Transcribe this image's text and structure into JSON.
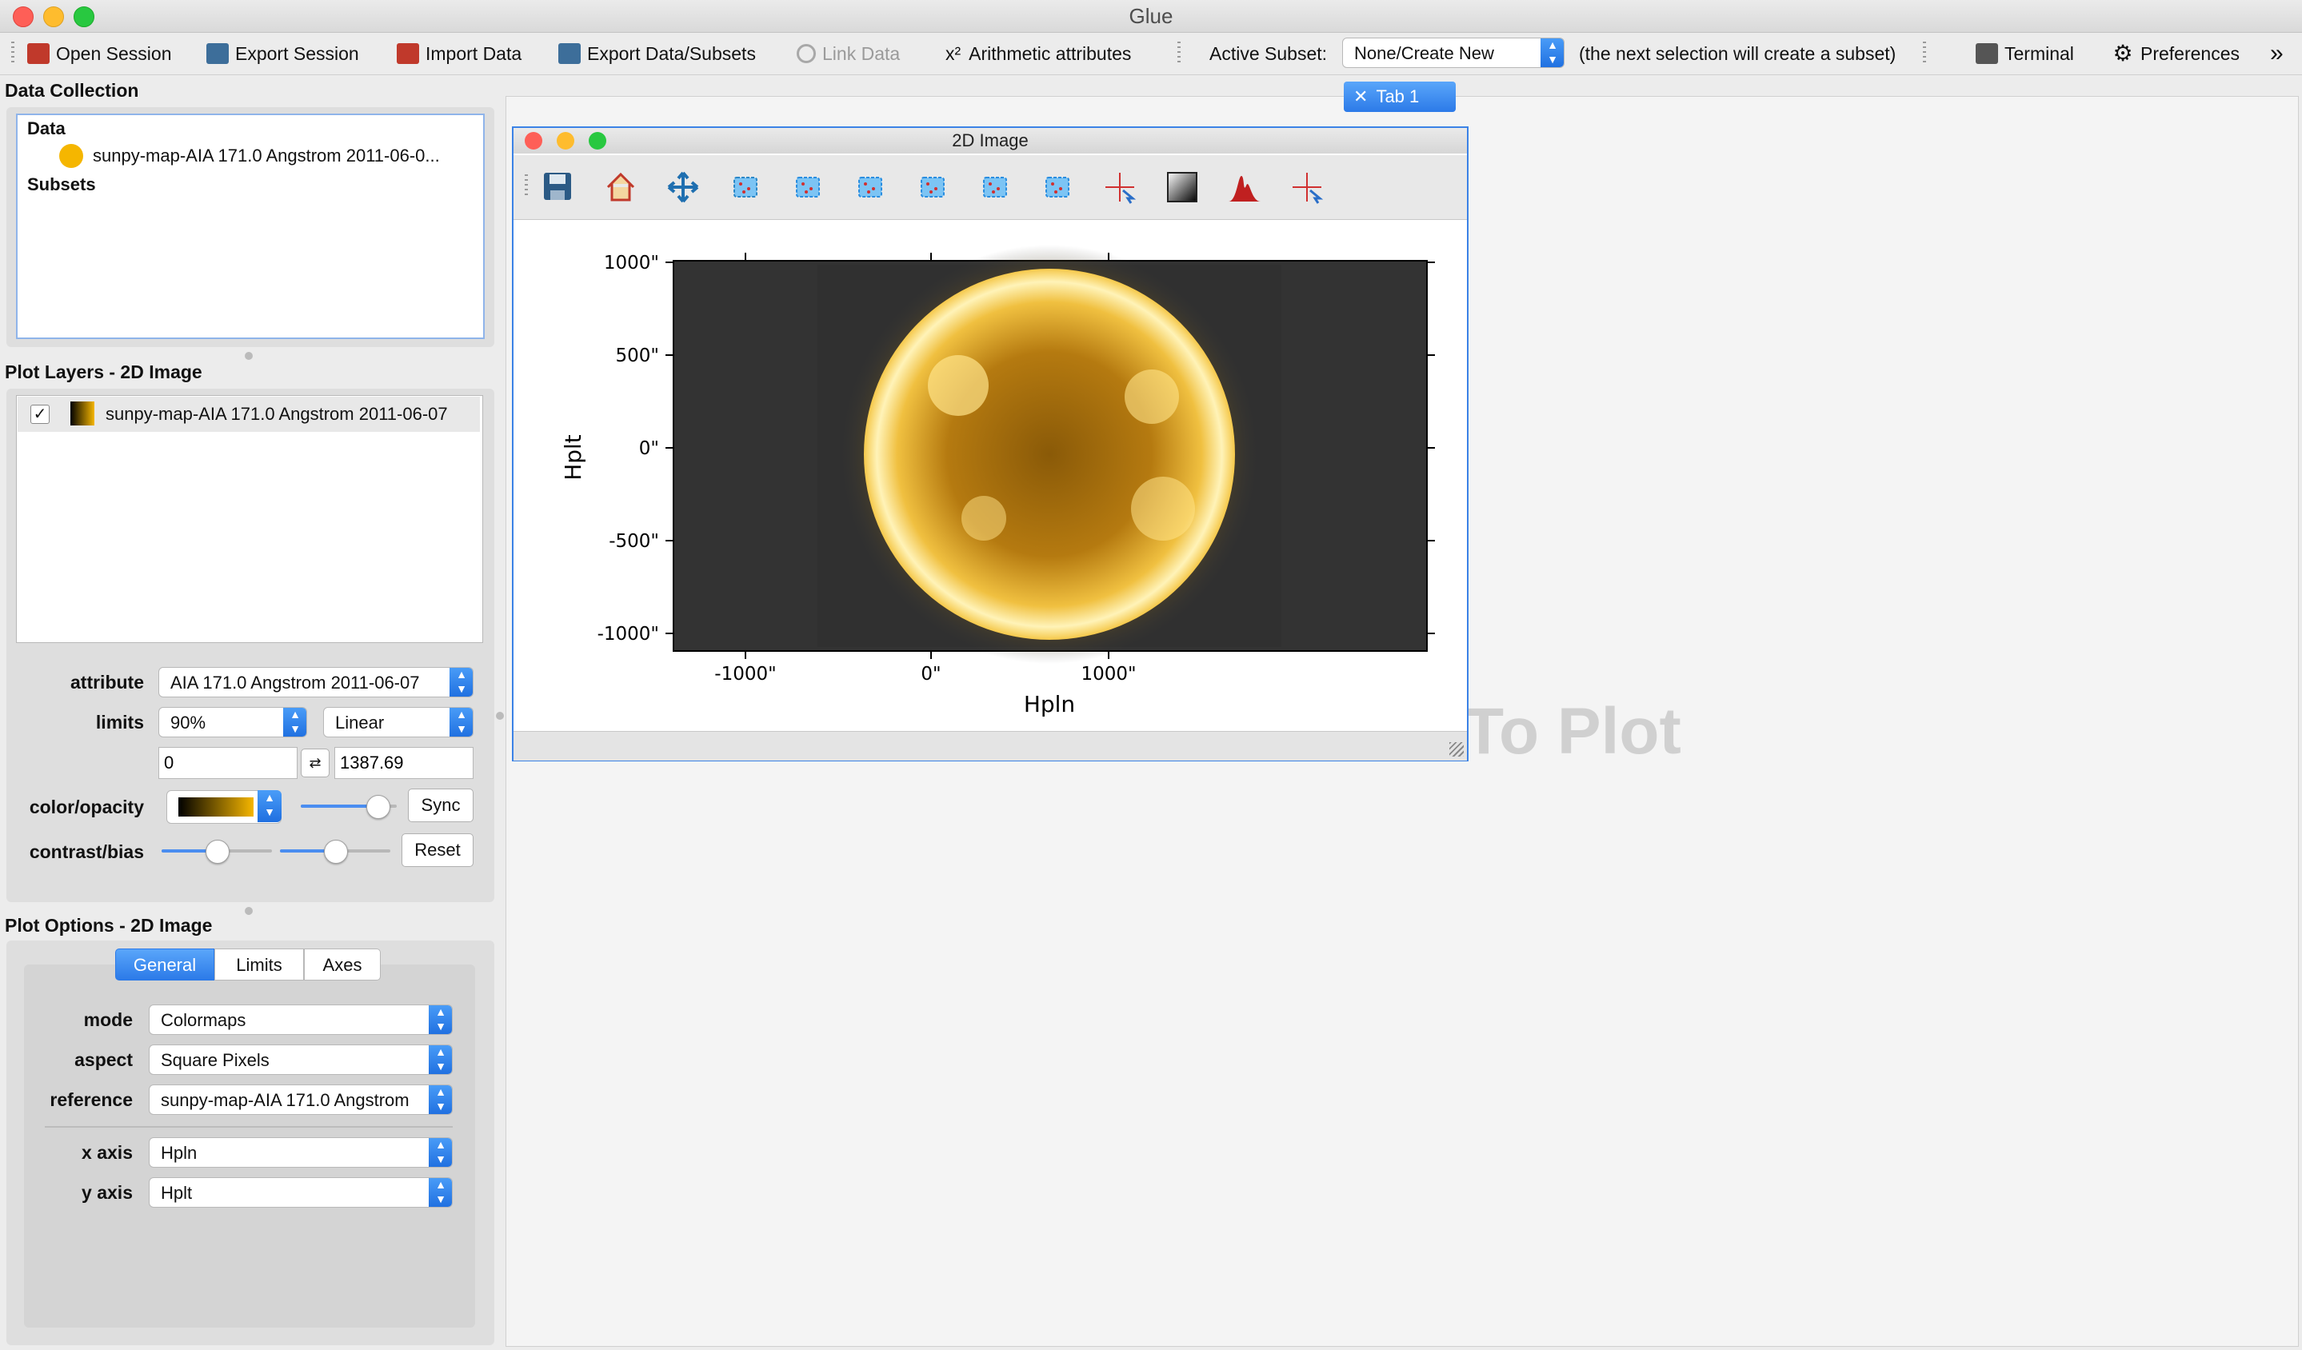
{
  "window": {
    "title": "Glue"
  },
  "toolbar": {
    "open_session": "Open Session",
    "export_session": "Export Session",
    "import_data": "Import Data",
    "export_data_subsets": "Export Data/Subsets",
    "link_data": "Link Data",
    "arithmetic_prefix": "x²",
    "arithmetic": "Arithmetic attributes",
    "active_subset_label": "Active Subset:",
    "active_subset_value": "None/Create New",
    "subset_hint": "(the next selection will create a subset)",
    "terminal": "Terminal",
    "preferences": "Preferences",
    "overflow": "»"
  },
  "tab_bar": {
    "tab1": "Tab 1",
    "close": "✕"
  },
  "data_collection": {
    "title": "Data Collection",
    "data_header": "Data",
    "data_item": "sunpy-map-AIA 171.0 Angstrom 2011-06-0...",
    "subsets_header": "Subsets",
    "data_color": "#f5b600"
  },
  "plot_layers": {
    "title": "Plot Layers - 2D Image",
    "layer_label": "sunpy-map-AIA 171.0 Angstrom 2011-06-07",
    "layer_checked": true
  },
  "layer_options": {
    "attribute_label": "attribute",
    "attribute_value": "AIA 171.0 Angstrom 2011-06-07",
    "limits_label": "limits",
    "limits_percentile": "90%",
    "limits_stretch": "Linear",
    "limit_min": "0",
    "limit_max": "1387.69",
    "swap_icon": "⇄",
    "color_label": "color/opacity",
    "sync": "Sync",
    "contrast_label": "contrast/bias",
    "reset": "Reset",
    "opacity_fraction": 0.8,
    "contrast_fraction": 0.5,
    "bias_fraction": 0.5
  },
  "plot_options": {
    "title": "Plot Options - 2D Image",
    "tabs": [
      "General",
      "Limits",
      "Axes"
    ],
    "active_tab": "General",
    "mode_label": "mode",
    "mode_value": "Colormaps",
    "aspect_label": "aspect",
    "aspect_value": "Square Pixels",
    "reference_label": "reference",
    "reference_value": "sunpy-map-AIA 171.0 Angstrom",
    "xaxis_label": "x axis",
    "xaxis_value": "Hpln",
    "yaxis_label": "y axis",
    "yaxis_value": "Hplt"
  },
  "background_hint": {
    "text": "To Plot"
  },
  "image_viewer": {
    "title": "2D Image",
    "xlabel": "Hpln",
    "ylabel": "Hplt",
    "xticks": [
      "-1000\"",
      "0\"",
      "1000\""
    ],
    "yticks": [
      "1000\"",
      "500\"",
      "0\"",
      "-500\"",
      "-1000\""
    ],
    "tools": [
      "save-icon",
      "home-icon",
      "pan-icon",
      "zoom-icon",
      "rectangle-select-icon",
      "xrange-select-icon",
      "yrange-select-icon",
      "circle-select-icon",
      "polygon-select-icon",
      "crosshair-icon",
      "contrast-icon",
      "histogram-icon",
      "pixel-info-icon"
    ]
  }
}
